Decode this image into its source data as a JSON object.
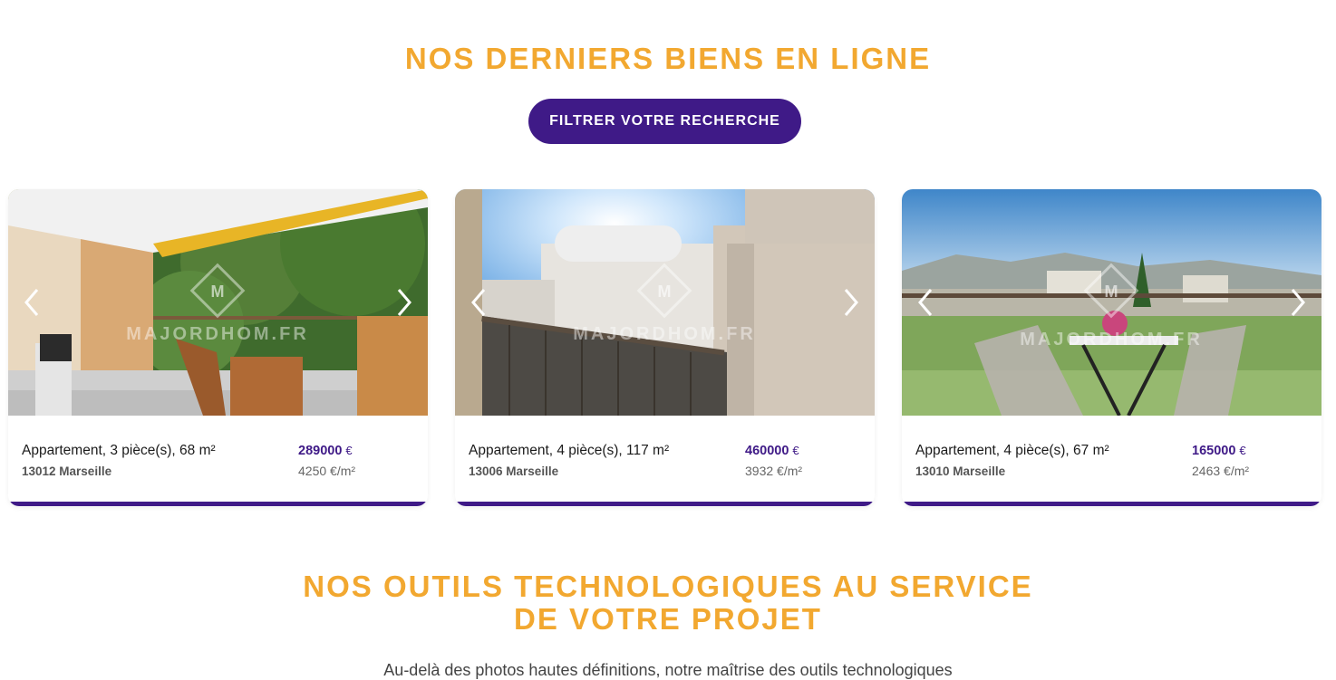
{
  "section1": {
    "title": "NOS DERNIERS BIENS EN LIGNE",
    "filter_button": "FILTRER VOTRE RECHERCHE"
  },
  "watermark": "MAJORDHOM.FR",
  "listings": [
    {
      "type": "Appartement, 3 pièce(s), 68 m²",
      "city": "13012 Marseille",
      "price": "289000",
      "currency": "€",
      "price_m2": "4250 €/m²"
    },
    {
      "type": "Appartement, 4 pièce(s), 117 m²",
      "city": "13006 Marseille",
      "price": "460000",
      "currency": "€",
      "price_m2": "3932 €/m²"
    },
    {
      "type": "Appartement, 4 pièce(s), 67 m²",
      "city": "13010 Marseille",
      "price": "165000",
      "currency": "€",
      "price_m2": "2463 €/m²"
    }
  ],
  "section2": {
    "title_line1": "NOS OUTILS TECHNOLOGIQUES AU SERVICE",
    "title_line2": "DE VOTRE PROJET",
    "lead": "Au-delà des photos hautes définitions, notre maîtrise des outils technologiques"
  },
  "colors": {
    "accent": "#f2a830",
    "brand": "#3f1a87"
  },
  "icons": [
    "chevron-left-icon",
    "chevron-right-icon",
    "majordhom-logo-icon"
  ]
}
